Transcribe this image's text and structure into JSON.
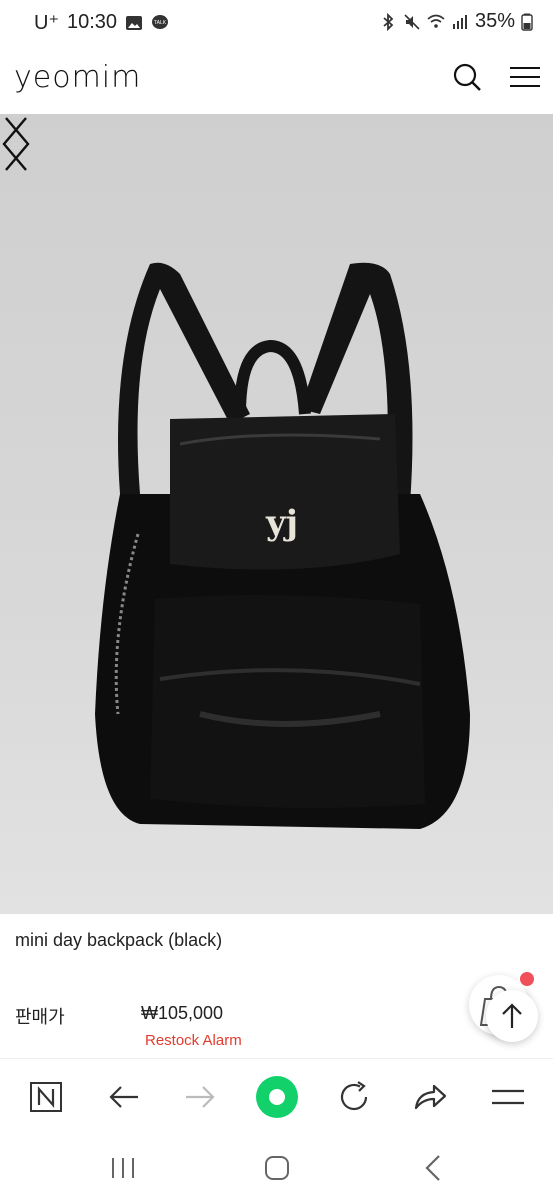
{
  "status_bar": {
    "carrier": "U⁺",
    "time": "10:30",
    "battery": "35%"
  },
  "header": {
    "logo": "yeomim",
    "icons": [
      "search-icon",
      "hamburger-menu-icon"
    ]
  },
  "product": {
    "name": "mini day backpack (black)",
    "price_label": "판매가",
    "price": "₩105,000",
    "restock_label": "Restock Alarm"
  },
  "browser_toolbar": {
    "buttons": [
      "naver-n-icon",
      "back-arrow-icon",
      "forward-arrow-icon",
      "home-green-icon",
      "refresh-icon",
      "share-icon",
      "menu-icon"
    ]
  },
  "colors": {
    "restock": "#e23b2e",
    "accent_green": "#12d06a",
    "notification_dot": "#f0505a"
  }
}
